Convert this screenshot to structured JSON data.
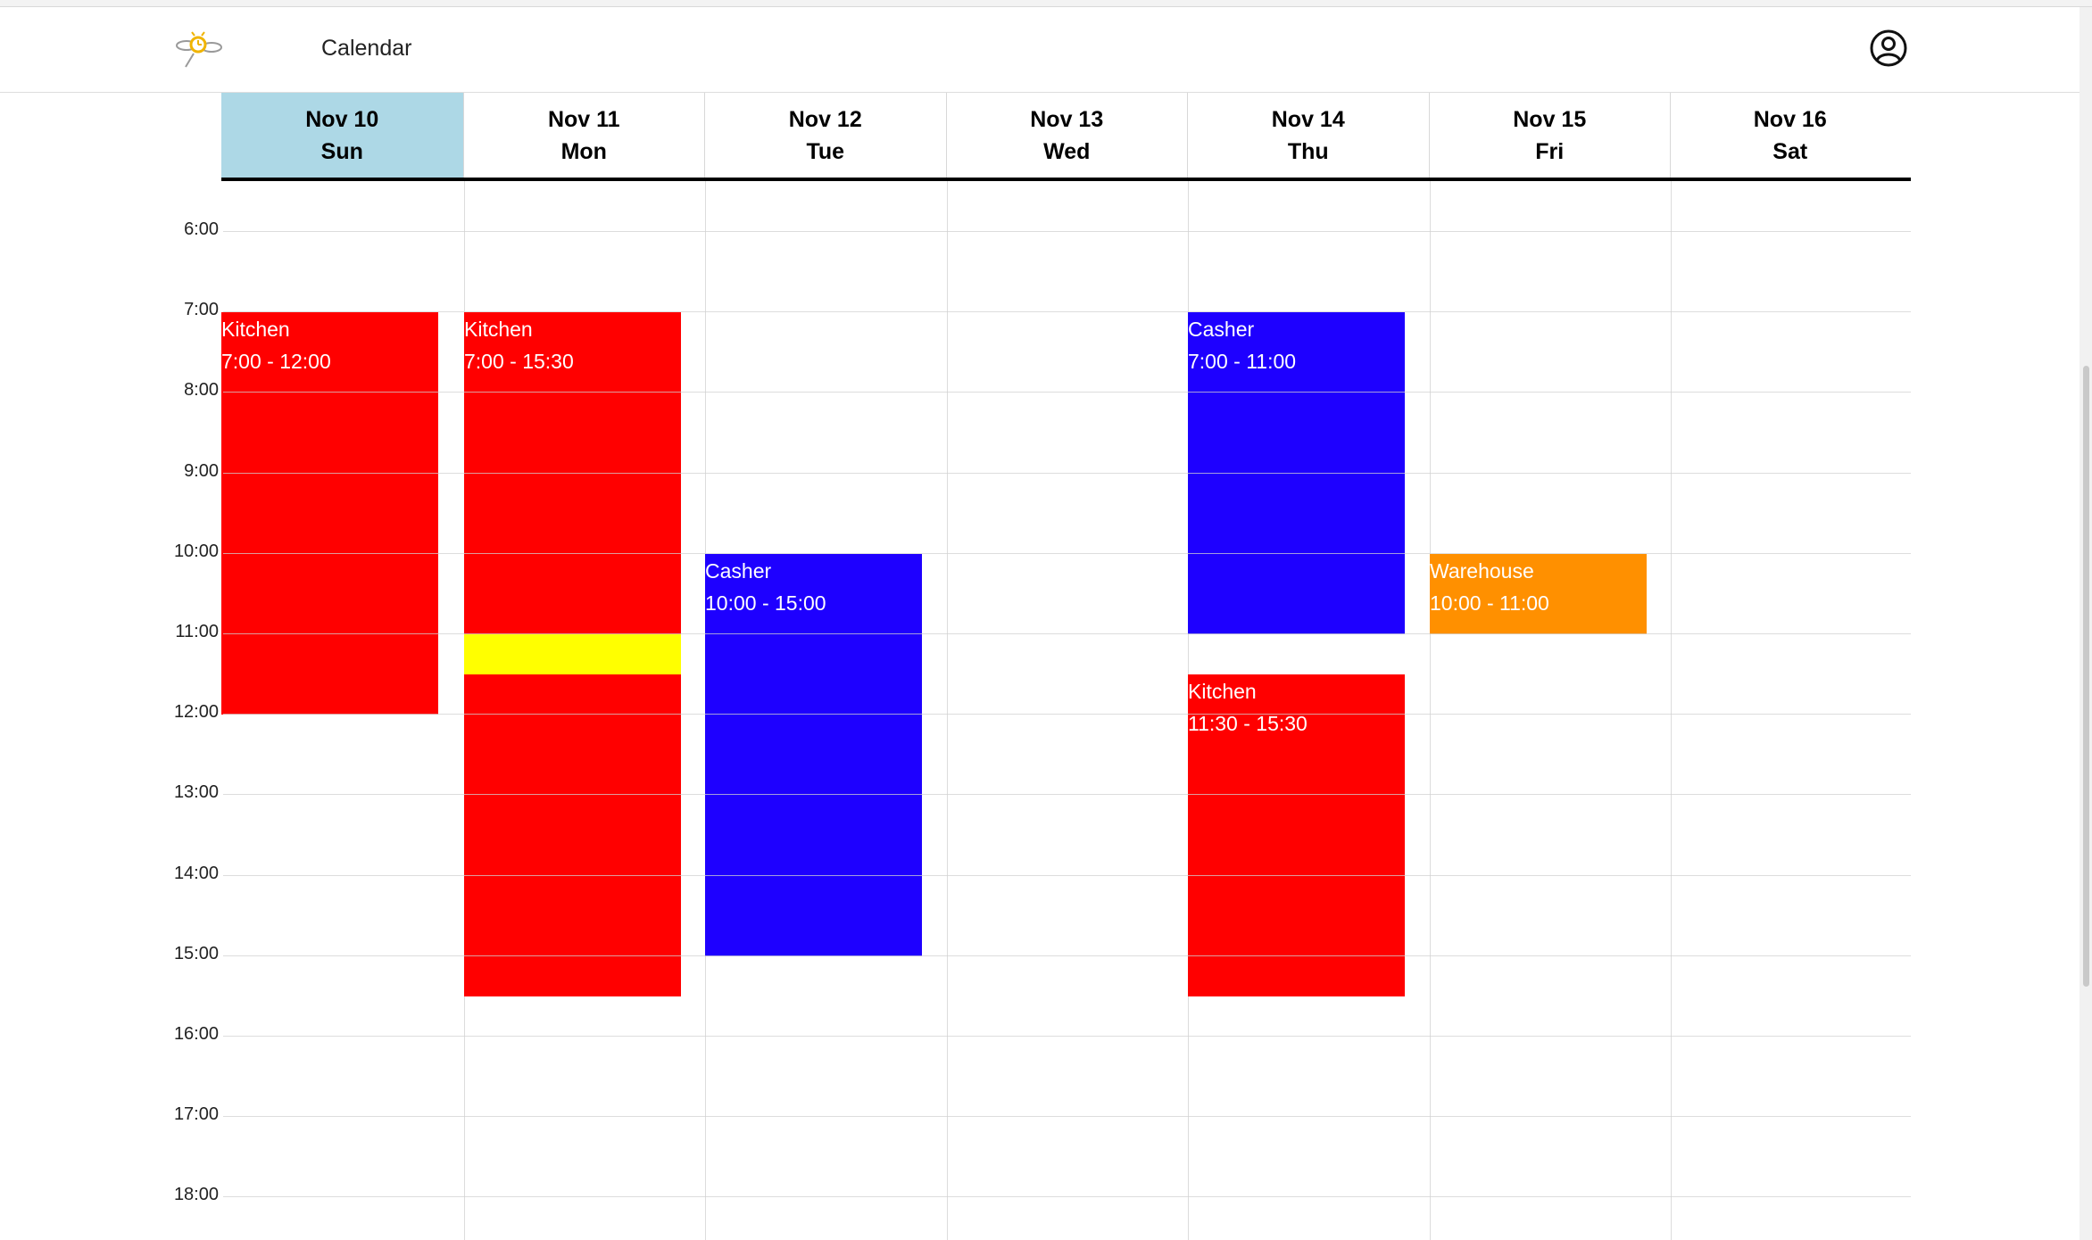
{
  "app": {
    "title": "Calendar"
  },
  "icons": {
    "logo": "app-logo-icon",
    "user": "user-circle-icon"
  },
  "days": [
    {
      "date": "Nov 10",
      "dow": "Sun",
      "today": true
    },
    {
      "date": "Nov 11",
      "dow": "Mon",
      "today": false
    },
    {
      "date": "Nov 12",
      "dow": "Tue",
      "today": false
    },
    {
      "date": "Nov 13",
      "dow": "Wed",
      "today": false
    },
    {
      "date": "Nov 14",
      "dow": "Thu",
      "today": false
    },
    {
      "date": "Nov 15",
      "dow": "Fri",
      "today": false
    },
    {
      "date": "Nov 16",
      "dow": "Sat",
      "today": false
    }
  ],
  "hours": [
    "6:00",
    "7:00",
    "8:00",
    "9:00",
    "10:00",
    "11:00",
    "12:00",
    "13:00",
    "14:00",
    "15:00",
    "16:00",
    "17:00",
    "18:00"
  ],
  "shifts": [
    {
      "day": 0,
      "role": "Kitchen",
      "time": "7:00 - 12:00",
      "start": 7,
      "end": 12,
      "color": "#ff0000"
    },
    {
      "day": 1,
      "role": "Kitchen",
      "time": "7:00 - 15:30",
      "start": 7,
      "end": 15.5,
      "color": "#ff0000"
    },
    {
      "day": 1,
      "role": "",
      "time": "",
      "start": 11,
      "end": 11.5,
      "color": "#ffff00"
    },
    {
      "day": 2,
      "role": "Casher",
      "time": "10:00 - 15:00",
      "start": 10,
      "end": 15,
      "color": "#1e00ff"
    },
    {
      "day": 4,
      "role": "Casher",
      "time": "7:00 - 11:00",
      "start": 7,
      "end": 11,
      "color": "#1e00ff"
    },
    {
      "day": 4,
      "role": "Kitchen",
      "time": "11:30 - 15:30",
      "start": 11.5,
      "end": 15.5,
      "color": "#ff0000"
    },
    {
      "day": 5,
      "role": "Warehouse",
      "time": "10:00 - 11:00",
      "start": 10,
      "end": 11,
      "color": "#ff9000"
    }
  ],
  "colors": {
    "today_bg": "#add8e6",
    "grid": "#dcdcdc"
  }
}
